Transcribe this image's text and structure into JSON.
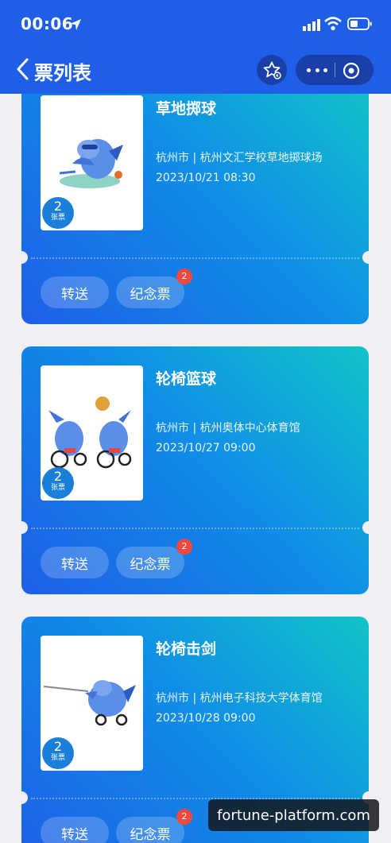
{
  "status_bar": {
    "time": "00:06",
    "icons": [
      "location-arrow-icon",
      "signal-icon",
      "wifi-icon",
      "battery-icon"
    ]
  },
  "nav": {
    "back_icon": "chevron-left-icon",
    "title": "票列表",
    "favorite_icon": "star-icon",
    "more_icon": "more-dots-icon",
    "close_icon": "target-icon"
  },
  "colors": {
    "header": "#1f5fe8",
    "card_gradient_start": "#1f5fe8",
    "card_gradient_end": "#13c4c8",
    "badge_red": "#f0493e"
  },
  "tickets": [
    {
      "title": "草地掷球",
      "venue": "杭州市 | 杭州文汇学校草地掷球场",
      "datetime": "2023/10/21 08:30",
      "count": "2",
      "count_unit": "张票",
      "transfer_label": "转送",
      "souvenir_label": "纪念票",
      "souvenir_badge": "2"
    },
    {
      "title": "轮椅篮球",
      "venue": "杭州市 | 杭州奥体中心体育馆",
      "datetime": "2023/10/27 09:00",
      "count": "2",
      "count_unit": "张票",
      "transfer_label": "转送",
      "souvenir_label": "纪念票",
      "souvenir_badge": "2"
    },
    {
      "title": "轮椅击剑",
      "venue": "杭州市 | 杭州电子科技大学体育馆",
      "datetime": "2023/10/28 09:00",
      "count": "2",
      "count_unit": "张票",
      "transfer_label": "转送",
      "souvenir_label": "纪念票",
      "souvenir_badge": "2"
    }
  ],
  "watermark": "fortune-platform.com"
}
